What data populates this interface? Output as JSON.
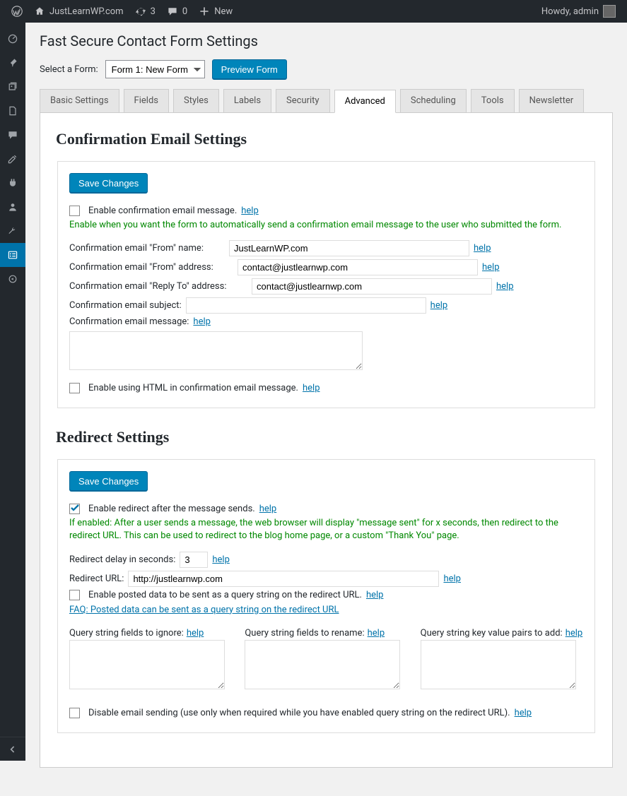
{
  "adminbar": {
    "site_name": "JustLearnWP.com",
    "updates": "3",
    "comments": "0",
    "new": "New",
    "howdy": "Howdy, admin"
  },
  "page": {
    "title": "Fast Secure Contact Form Settings",
    "select_label": "Select a Form:",
    "select_value": "Form 1: New Form",
    "preview_btn": "Preview Form"
  },
  "tabs": {
    "basic": "Basic Settings",
    "fields": "Fields",
    "styles": "Styles",
    "labels": "Labels",
    "security": "Security",
    "advanced": "Advanced",
    "scheduling": "Scheduling",
    "tools": "Tools",
    "newsletter": "Newsletter"
  },
  "confirm": {
    "heading": "Confirmation Email Settings",
    "save": "Save Changes",
    "enable_msg": "Enable confirmation email message.",
    "help": "help",
    "green": "Enable when you want the form to automatically send a confirmation email message to the user who submitted the form.",
    "from_name_label": "Confirmation email \"From\" name:",
    "from_name_value": "JustLearnWP.com",
    "from_addr_label": "Confirmation email \"From\" address:",
    "from_addr_value": "contact@justlearnwp.com",
    "reply_label": "Confirmation email \"Reply To\" address:",
    "reply_value": "contact@justlearnwp.com",
    "subject_label": "Confirmation email subject:",
    "subject_value": "",
    "message_label": "Confirmation email message:",
    "enable_html": "Enable using HTML in confirmation email message."
  },
  "redirect": {
    "heading": "Redirect Settings",
    "save": "Save Changes",
    "enable": "Enable redirect after the message sends.",
    "green": "If enabled: After a user sends a message, the web browser will display \"message sent\" for x seconds, then redirect to the redirect URL. This can be used to redirect to the blog home page, or a custom \"Thank You\" page.",
    "delay_label": "Redirect delay in seconds:",
    "delay_value": "3",
    "url_label": "Redirect URL:",
    "url_value": "http://justlearnwp.com",
    "enable_qs": "Enable posted data to be sent as a query string on the redirect URL.",
    "faq": "FAQ: Posted data can be sent as a query string on the redirect URL",
    "qs_ignore": "Query string fields to ignore:",
    "qs_rename": "Query string fields to rename:",
    "qs_add": "Query string key value pairs to add:",
    "disable_email": "Disable email sending (use only when required while you have enabled query string on the redirect URL).",
    "help": "help"
  }
}
